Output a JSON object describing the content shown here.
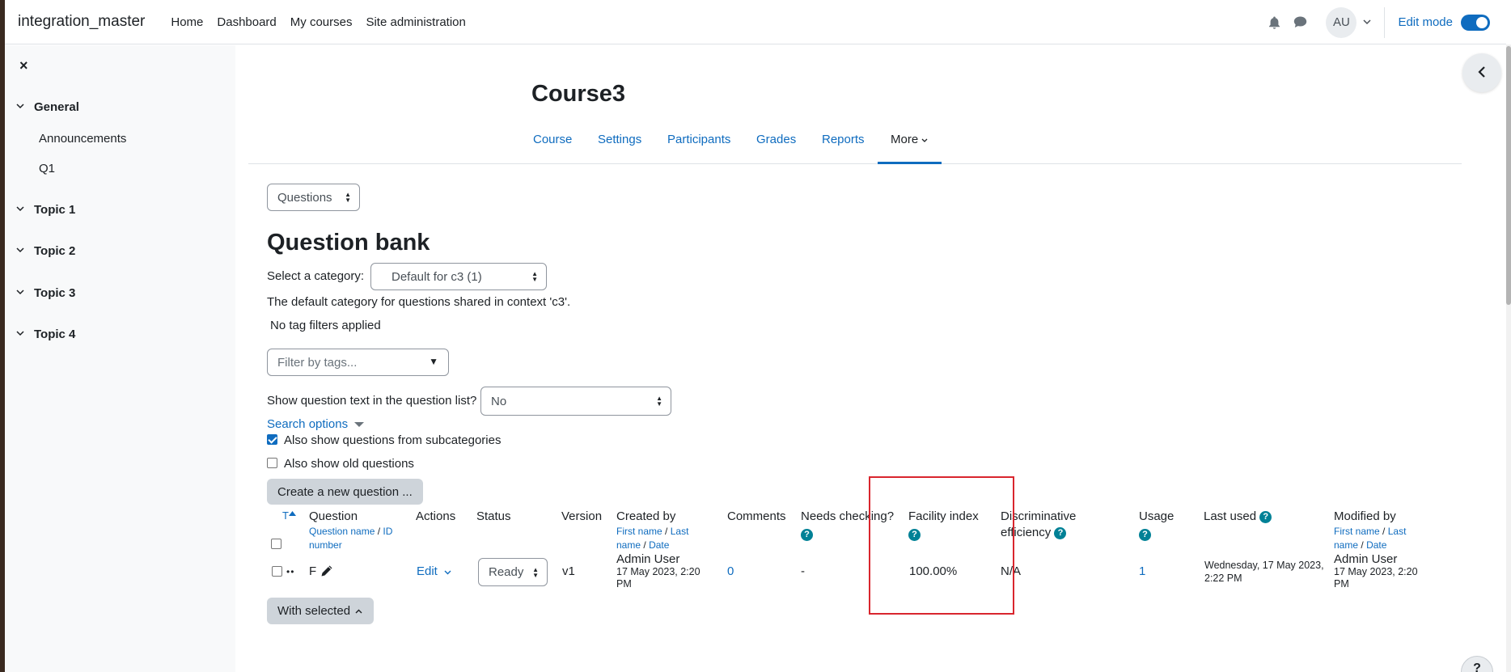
{
  "navbar": {
    "brand": "integration_master",
    "links": [
      "Home",
      "Dashboard",
      "My courses",
      "Site administration"
    ],
    "avatar_initials": "AU",
    "edit_mode_label": "Edit mode",
    "edit_mode_on": true
  },
  "drawer": {
    "close_glyph": "×",
    "sections": [
      {
        "label": "General",
        "items": [
          "Announcements",
          "Q1"
        ]
      },
      {
        "label": "Topic 1"
      },
      {
        "label": "Topic 2"
      },
      {
        "label": "Topic 3"
      },
      {
        "label": "Topic 4"
      }
    ]
  },
  "course": {
    "title": "Course3",
    "tabs": [
      "Course",
      "Settings",
      "Participants",
      "Grades",
      "Reports",
      "More"
    ],
    "active_tab": "More"
  },
  "question_bank": {
    "nav_select": "Questions",
    "title": "Question bank",
    "category_label": "Select a category:",
    "category_value": "Default for c3 (1)",
    "category_description": "The default category for questions shared in context 'c3'.",
    "tag_status": "No tag filters applied",
    "tag_filter_placeholder": "Filter by tags...",
    "show_text_label": "Show question text in the question list?",
    "show_text_value": "No",
    "search_options": "Search options",
    "subcategories_label": "Also show questions from subcategories",
    "subcategories_checked": true,
    "old_questions_label": "Also show old questions",
    "old_questions_checked": false,
    "create_button": "Create a new question ...",
    "with_selected_button": "With selected"
  },
  "table": {
    "headers": {
      "type": "T",
      "question": "Question",
      "question_sub_1": "Question name",
      "question_sub_sep": "/",
      "question_sub_2": "ID",
      "question_sub_3": "number",
      "actions": "Actions",
      "status": "Status",
      "version": "Version",
      "created_by": "Created by",
      "created_sub_1": "First name",
      "created_sub_sep": "/",
      "created_sub_2": "Last",
      "created_sub_3": "name",
      "created_sub_sep2": "/",
      "created_sub_4": "Date",
      "comments": "Comments",
      "needs_checking": "Needs checking?",
      "facility_index": "Facility index",
      "discriminative_1": "Discriminative",
      "discriminative_2": "efficiency",
      "usage": "Usage",
      "last_used": "Last used",
      "modified_by": "Modified by",
      "modified_sub_1": "First name",
      "modified_sub_sep": "/",
      "modified_sub_2": "Last",
      "modified_sub_3": "name",
      "modified_sub_sep2": "/",
      "modified_sub_4": "Date",
      "help_glyph": "?"
    },
    "rows": [
      {
        "type_glyph": "••",
        "question": "F",
        "action": "Edit",
        "status": "Ready",
        "version": "v1",
        "created_by_name": "Admin User",
        "created_date_1": "17 May 2023, 2:20",
        "created_date_2": "PM",
        "comments": "0",
        "needs_checking": "-",
        "facility_index": "100.00%",
        "discriminative_efficiency": "N/A",
        "usage": "1",
        "last_used_1": "Wednesday, 17 May 2023,",
        "last_used_2": "2:22 PM",
        "modified_by_name": "Admin User",
        "modified_date_1": "17 May 2023, 2:20",
        "modified_date_2": "PM"
      }
    ]
  },
  "footer": {
    "help_glyph": "?"
  },
  "colors": {
    "link": "#0f6cbf",
    "help": "#008196",
    "highlight": "#d9262e"
  }
}
